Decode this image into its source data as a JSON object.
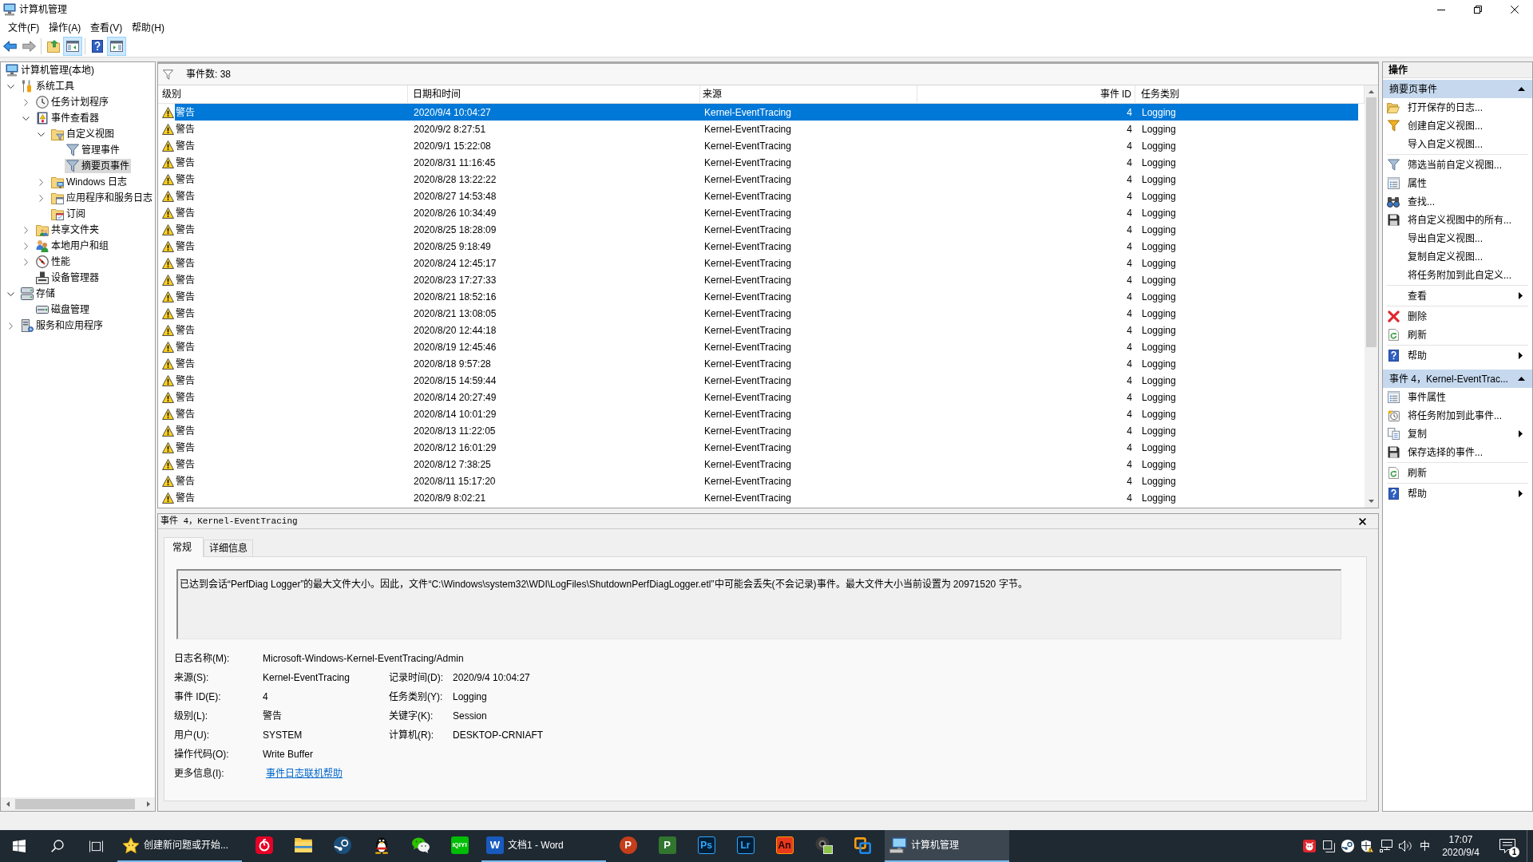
{
  "window": {
    "title": "计算机管理"
  },
  "menu": [
    {
      "label": "文件(F)"
    },
    {
      "label": "操作(A)"
    },
    {
      "label": "查看(V)"
    },
    {
      "label": "帮助(H)"
    }
  ],
  "toolbar": [
    {
      "disabled": false,
      "pressed": false
    },
    {
      "disabled": true,
      "pressed": false
    },
    {
      "disabled": false,
      "pressed": false
    },
    {
      "disabled": false,
      "pressed": true
    },
    {
      "disabled": false,
      "pressed": false
    },
    {
      "disabled": false,
      "pressed": true
    }
  ],
  "tree": [
    {
      "label": "计算机管理(本地)",
      "selected": false,
      "children": [
        {
          "label": "系统工具",
          "selected": false,
          "expanded": true,
          "children": [
            {
              "label": "任务计划程序",
              "selected": false,
              "expanded": false
            },
            {
              "label": "事件查看器",
              "selected": false,
              "expanded": true,
              "children": [
                {
                  "label": "自定义视图",
                  "selected": false,
                  "expanded": true,
                  "children": [
                    {
                      "label": "管理事件",
                      "selected": false
                    },
                    {
                      "label": "摘要页事件",
                      "selected": true
                    }
                  ]
                },
                {
                  "label": "Windows 日志",
                  "selected": false,
                  "expanded": false
                },
                {
                  "label": "应用程序和服务日志",
                  "selected": false,
                  "expanded": false
                },
                {
                  "label": "订阅",
                  "selected": false
                }
              ]
            },
            {
              "label": "共享文件夹",
              "selected": false,
              "expanded": false
            },
            {
              "label": "本地用户和组",
              "selected": false,
              "expanded": false
            },
            {
              "label": "性能",
              "selected": false,
              "expanded": false
            },
            {
              "label": "设备管理器",
              "selected": false
            }
          ]
        },
        {
          "label": "存储",
          "selected": false,
          "expanded": true,
          "children": [
            {
              "label": "磁盘管理",
              "selected": false
            }
          ]
        },
        {
          "label": "服务和应用程序",
          "selected": false,
          "expanded": false
        }
      ]
    }
  ],
  "event_list": {
    "count": "事件数: 38",
    "columns": [
      "级别",
      "日期和时间",
      "来源",
      "事件 ID",
      "任务类别"
    ],
    "rows": [
      {
        "level": "警告",
        "date_time": "2020/9/4 10:04:27",
        "source": "Kernel-EventTracing",
        "event_id": "4",
        "task_category": "Logging",
        "selected": true
      },
      {
        "level": "警告",
        "date_time": "2020/9/2 8:27:51",
        "source": "Kernel-EventTracing",
        "event_id": "4",
        "task_category": "Logging",
        "selected": false
      },
      {
        "level": "警告",
        "date_time": "2020/9/1 15:22:08",
        "source": "Kernel-EventTracing",
        "event_id": "4",
        "task_category": "Logging",
        "selected": false
      },
      {
        "level": "警告",
        "date_time": "2020/8/31 11:16:45",
        "source": "Kernel-EventTracing",
        "event_id": "4",
        "task_category": "Logging",
        "selected": false
      },
      {
        "level": "警告",
        "date_time": "2020/8/28 13:22:22",
        "source": "Kernel-EventTracing",
        "event_id": "4",
        "task_category": "Logging",
        "selected": false
      },
      {
        "level": "警告",
        "date_time": "2020/8/27 14:53:48",
        "source": "Kernel-EventTracing",
        "event_id": "4",
        "task_category": "Logging",
        "selected": false
      },
      {
        "level": "警告",
        "date_time": "2020/8/26 10:34:49",
        "source": "Kernel-EventTracing",
        "event_id": "4",
        "task_category": "Logging",
        "selected": false
      },
      {
        "level": "警告",
        "date_time": "2020/8/25 18:28:09",
        "source": "Kernel-EventTracing",
        "event_id": "4",
        "task_category": "Logging",
        "selected": false
      },
      {
        "level": "警告",
        "date_time": "2020/8/25 9:18:49",
        "source": "Kernel-EventTracing",
        "event_id": "4",
        "task_category": "Logging",
        "selected": false
      },
      {
        "level": "警告",
        "date_time": "2020/8/24 12:45:17",
        "source": "Kernel-EventTracing",
        "event_id": "4",
        "task_category": "Logging",
        "selected": false
      },
      {
        "level": "警告",
        "date_time": "2020/8/23 17:27:33",
        "source": "Kernel-EventTracing",
        "event_id": "4",
        "task_category": "Logging",
        "selected": false
      },
      {
        "level": "警告",
        "date_time": "2020/8/21 18:52:16",
        "source": "Kernel-EventTracing",
        "event_id": "4",
        "task_category": "Logging",
        "selected": false
      },
      {
        "level": "警告",
        "date_time": "2020/8/21 13:08:05",
        "source": "Kernel-EventTracing",
        "event_id": "4",
        "task_category": "Logging",
        "selected": false
      },
      {
        "level": "警告",
        "date_time": "2020/8/20 12:44:18",
        "source": "Kernel-EventTracing",
        "event_id": "4",
        "task_category": "Logging",
        "selected": false
      },
      {
        "level": "警告",
        "date_time": "2020/8/19 12:45:46",
        "source": "Kernel-EventTracing",
        "event_id": "4",
        "task_category": "Logging",
        "selected": false
      },
      {
        "level": "警告",
        "date_time": "2020/8/18 9:57:28",
        "source": "Kernel-EventTracing",
        "event_id": "4",
        "task_category": "Logging",
        "selected": false
      },
      {
        "level": "警告",
        "date_time": "2020/8/15 14:59:44",
        "source": "Kernel-EventTracing",
        "event_id": "4",
        "task_category": "Logging",
        "selected": false
      },
      {
        "level": "警告",
        "date_time": "2020/8/14 20:27:49",
        "source": "Kernel-EventTracing",
        "event_id": "4",
        "task_category": "Logging",
        "selected": false
      },
      {
        "level": "警告",
        "date_time": "2020/8/14 10:01:29",
        "source": "Kernel-EventTracing",
        "event_id": "4",
        "task_category": "Logging",
        "selected": false
      },
      {
        "level": "警告",
        "date_time": "2020/8/13 11:22:05",
        "source": "Kernel-EventTracing",
        "event_id": "4",
        "task_category": "Logging",
        "selected": false
      },
      {
        "level": "警告",
        "date_time": "2020/8/12 16:01:29",
        "source": "Kernel-EventTracing",
        "event_id": "4",
        "task_category": "Logging",
        "selected": false
      },
      {
        "level": "警告",
        "date_time": "2020/8/12 7:38:25",
        "source": "Kernel-EventTracing",
        "event_id": "4",
        "task_category": "Logging",
        "selected": false
      },
      {
        "level": "警告",
        "date_time": "2020/8/11 15:17:20",
        "source": "Kernel-EventTracing",
        "event_id": "4",
        "task_category": "Logging",
        "selected": false
      },
      {
        "level": "警告",
        "date_time": "2020/8/9 8:02:21",
        "source": "Kernel-EventTracing",
        "event_id": "4",
        "task_category": "Logging",
        "selected": false
      }
    ]
  },
  "event_detail": {
    "title": "事件 4，Kernel-EventTracing",
    "tabs": [
      {
        "label": "常规",
        "selected": true
      },
      {
        "label": "详细信息",
        "selected": false
      }
    ],
    "description": "已达到会话“PerfDiag Logger”的最大文件大小。因此，文件“C:\\Windows\\system32\\WDI\\LogFiles\\ShutdownPerfDiagLogger.etl”中可能会丢失(不会记录)事件。最大文件大小当前设置为 20971520 字节。",
    "fields": [
      [
        {
          "label": "日志名称(M):",
          "value": "Microsoft-Windows-Kernel-EventTracing/Admin",
          "kind": "text"
        }
      ],
      [
        {
          "label": "来源(S):",
          "value": "Kernel-EventTracing",
          "kind": "text"
        },
        {
          "label": "记录时间(D):",
          "value": "2020/9/4 10:04:27",
          "kind": "text"
        }
      ],
      [
        {
          "label": "事件 ID(E):",
          "value": "4",
          "kind": "text"
        },
        {
          "label": "任务类别(Y):",
          "value": "Logging",
          "kind": "text"
        }
      ],
      [
        {
          "label": "级别(L):",
          "value": "警告",
          "kind": "text"
        },
        {
          "label": "关键字(K):",
          "value": "Session",
          "kind": "text"
        }
      ],
      [
        {
          "label": "用户(U):",
          "value": "SYSTEM",
          "kind": "text"
        },
        {
          "label": "计算机(R):",
          "value": "DESKTOP-CRNIAFT",
          "kind": "text"
        }
      ],
      [
        {
          "label": "操作代码(O):",
          "value": "Write Buffer",
          "kind": "text"
        }
      ],
      [
        {
          "label": "更多信息(I):",
          "value": "事件日志联机帮助",
          "kind": "link"
        }
      ]
    ]
  },
  "actions": {
    "title": "操作",
    "sections": [
      {
        "title": "摘要页事件",
        "expanded": true,
        "groups": [
          [
            {
              "label": "打开保存的日志...",
              "submenu": false
            },
            {
              "label": "创建自定义视图...",
              "submenu": false
            },
            {
              "label": "导入自定义视图...",
              "submenu": false
            }
          ],
          [
            {
              "label": "筛选当前自定义视图...",
              "submenu": false
            },
            {
              "label": "属性",
              "submenu": false
            },
            {
              "label": "查找...",
              "submenu": false
            },
            {
              "label": "将自定义视图中的所有...",
              "submenu": false
            },
            {
              "label": "导出自定义视图...",
              "submenu": false
            },
            {
              "label": "复制自定义视图...",
              "submenu": false
            },
            {
              "label": "将任务附加到此自定义...",
              "submenu": false
            }
          ],
          [
            {
              "label": "查看",
              "submenu": true
            }
          ],
          [
            {
              "label": "删除",
              "submenu": false
            },
            {
              "label": "刷新",
              "submenu": false
            }
          ],
          [
            {
              "label": "帮助",
              "submenu": true
            }
          ]
        ]
      },
      {
        "title": "事件 4，Kernel-EventTrac...",
        "expanded": true,
        "groups": [
          [
            {
              "label": "事件属性",
              "submenu": false
            },
            {
              "label": "将任务附加到此事件...",
              "submenu": false
            },
            {
              "label": "复制",
              "submenu": true
            },
            {
              "label": "保存选择的事件...",
              "submenu": false
            }
          ],
          [
            {
              "label": "刷新",
              "submenu": false
            }
          ],
          [
            {
              "label": "帮助",
              "submenu": true
            }
          ]
        ]
      }
    ]
  },
  "taskbar": {
    "apps": [
      {
        "label": "创建新问题或开始...",
        "running": true,
        "active": false
      },
      {
        "running": false,
        "active": false
      },
      {
        "running": false,
        "active": false
      },
      {
        "running": false,
        "active": false
      },
      {
        "running": false,
        "active": false
      },
      {
        "running": false,
        "active": false
      },
      {
        "logo_text": "iQIYI",
        "running": false,
        "active": false
      },
      {
        "logo_text": "W",
        "label": "文档1 - Word",
        "running": true,
        "active": false
      },
      {
        "logo_text": "P",
        "running": false,
        "active": false
      },
      {
        "logo_text": "P",
        "running": false,
        "active": false
      },
      {
        "logo_text": "Ps",
        "running": false,
        "active": false
      },
      {
        "logo_text": "Lr",
        "running": false,
        "active": false
      },
      {
        "logo_text": "An",
        "running": false,
        "active": false
      },
      {
        "running": false,
        "active": false
      },
      {
        "running": false,
        "active": false
      },
      {
        "label": "计算机管理",
        "running": true,
        "active": true
      }
    ],
    "ime": "中",
    "clock": {
      "time": "17:07",
      "date": "2020/9/4"
    },
    "notification_count": "1"
  }
}
